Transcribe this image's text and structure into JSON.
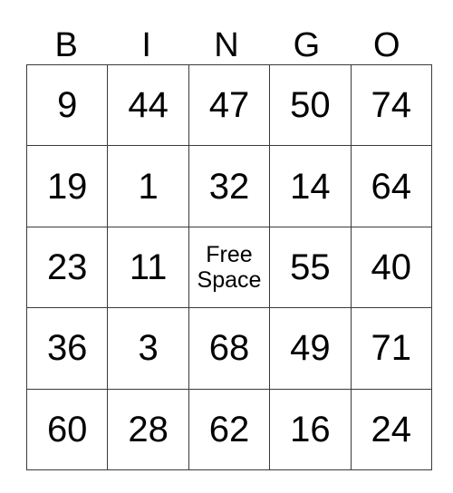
{
  "card": {
    "title": "BINGO",
    "headers": [
      "B",
      "I",
      "N",
      "G",
      "O"
    ],
    "free_space": {
      "line1": "Free",
      "line2": "Space"
    },
    "colors": {
      "background": "#ffffff",
      "border": "#3a3a3a",
      "text": "#000000"
    },
    "rows": [
      {
        "cells": [
          {
            "value": "9"
          },
          {
            "value": "44"
          },
          {
            "value": "47"
          },
          {
            "value": "50"
          },
          {
            "value": "74"
          }
        ]
      },
      {
        "cells": [
          {
            "value": "19"
          },
          {
            "value": "1"
          },
          {
            "value": "32"
          },
          {
            "value": "14"
          },
          {
            "value": "64"
          }
        ]
      },
      {
        "cells": [
          {
            "value": "23"
          },
          {
            "value": "11"
          },
          {
            "value": "Free Space"
          },
          {
            "value": "55"
          },
          {
            "value": "40"
          }
        ]
      },
      {
        "cells": [
          {
            "value": "36"
          },
          {
            "value": "3"
          },
          {
            "value": "68"
          },
          {
            "value": "49"
          },
          {
            "value": "71"
          }
        ]
      },
      {
        "cells": [
          {
            "value": "60"
          },
          {
            "value": "28"
          },
          {
            "value": "62"
          },
          {
            "value": "16"
          },
          {
            "value": "24"
          }
        ]
      }
    ]
  }
}
